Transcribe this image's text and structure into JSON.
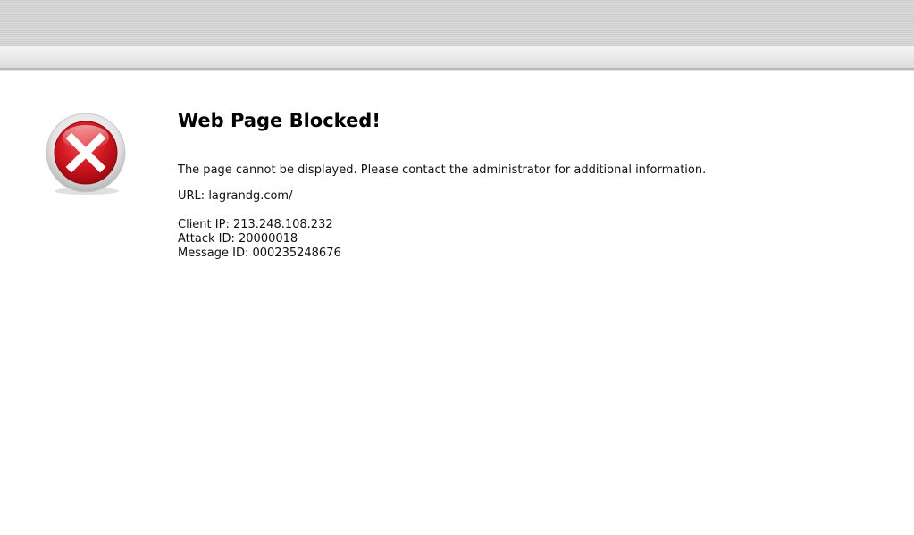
{
  "page": {
    "title": "Web Page Blocked!",
    "message": "The page cannot be displayed. Please contact the administrator for additional information.",
    "url_label": "URL:",
    "url_value": "lagrandg.com/",
    "client_ip_label": "Client IP:",
    "client_ip_value": "213.248.108.232",
    "attack_id_label": "Attack ID:",
    "attack_id_value": "20000018",
    "message_id_label": "Message ID:",
    "message_id_value": "000235248676"
  },
  "icons": {
    "error": "error-x-circle-icon"
  },
  "colors": {
    "error_red": "#d0121b",
    "text": "#111111"
  }
}
